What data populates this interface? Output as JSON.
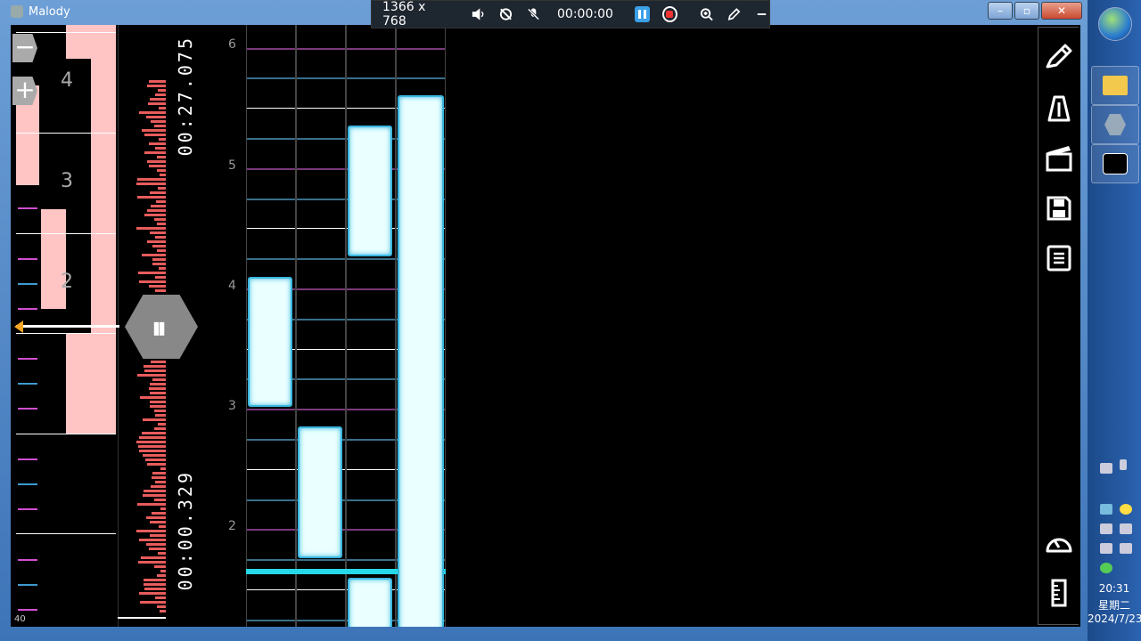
{
  "window": {
    "title": "Malody",
    "minimize": "–",
    "maximize": "▫",
    "close": "✕"
  },
  "recorder": {
    "resolution": "1366 x 768",
    "timer": "00:00:00"
  },
  "left_panel": {
    "beat_numbers": [
      "4",
      "3",
      "2"
    ],
    "zoom_out": "−",
    "zoom_in": "+",
    "bottom_number": "40",
    "time_top": "00:27.075",
    "time_bottom": "00:00.329"
  },
  "grid": {
    "measure_numbers": [
      "6",
      "5",
      "4",
      "3",
      "2"
    ]
  },
  "taskbar": {
    "time": "20:31",
    "weekday": "星期二",
    "date": "2024/7/23"
  },
  "colors": {
    "note_fill": "#eaffff",
    "note_border": "#3ab7e0",
    "beat_block": "#ffc4c4",
    "waveform": "#e85c5c",
    "cursor_line": "#26d9e8"
  },
  "icons": [
    "pencil-icon",
    "metronome-icon",
    "clapper-icon",
    "save-icon",
    "list-icon",
    "gauge-icon",
    "ruler-icon"
  ]
}
